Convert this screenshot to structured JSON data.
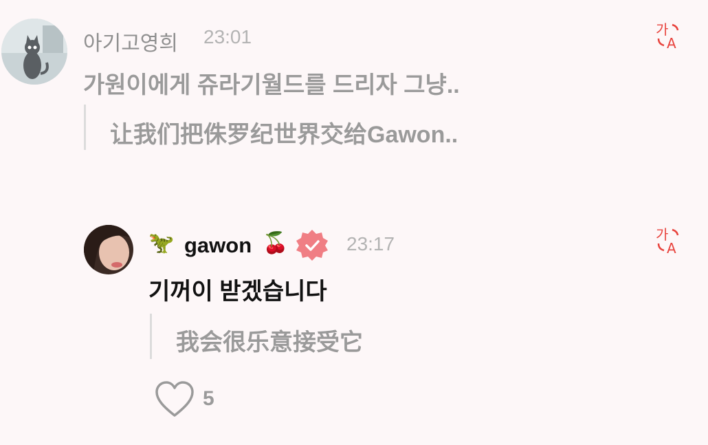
{
  "comment": {
    "author": "아기고영희",
    "time": "23:01",
    "text": "가원이에게 쥬라기월드를 드리자 그냥..",
    "translation": "让我们把侏罗纪世界交给Gawon..",
    "translate_icon": "translate-icon"
  },
  "reply": {
    "author_prefix_emoji": "🦖",
    "author": "gawon",
    "author_suffix_emoji": "🍒",
    "verified_icon": "verified-badge-icon",
    "time": "23:17",
    "text": "기꺼이 받겠습니다",
    "translation": "我会很乐意接受它",
    "translate_icon": "translate-icon",
    "like_icon": "heart-icon",
    "like_count": "5"
  },
  "colors": {
    "background": "#fdf7f8",
    "accent_red": "#e8423c",
    "badge_pink": "#f07e84",
    "muted_text": "#9a9a9a"
  }
}
